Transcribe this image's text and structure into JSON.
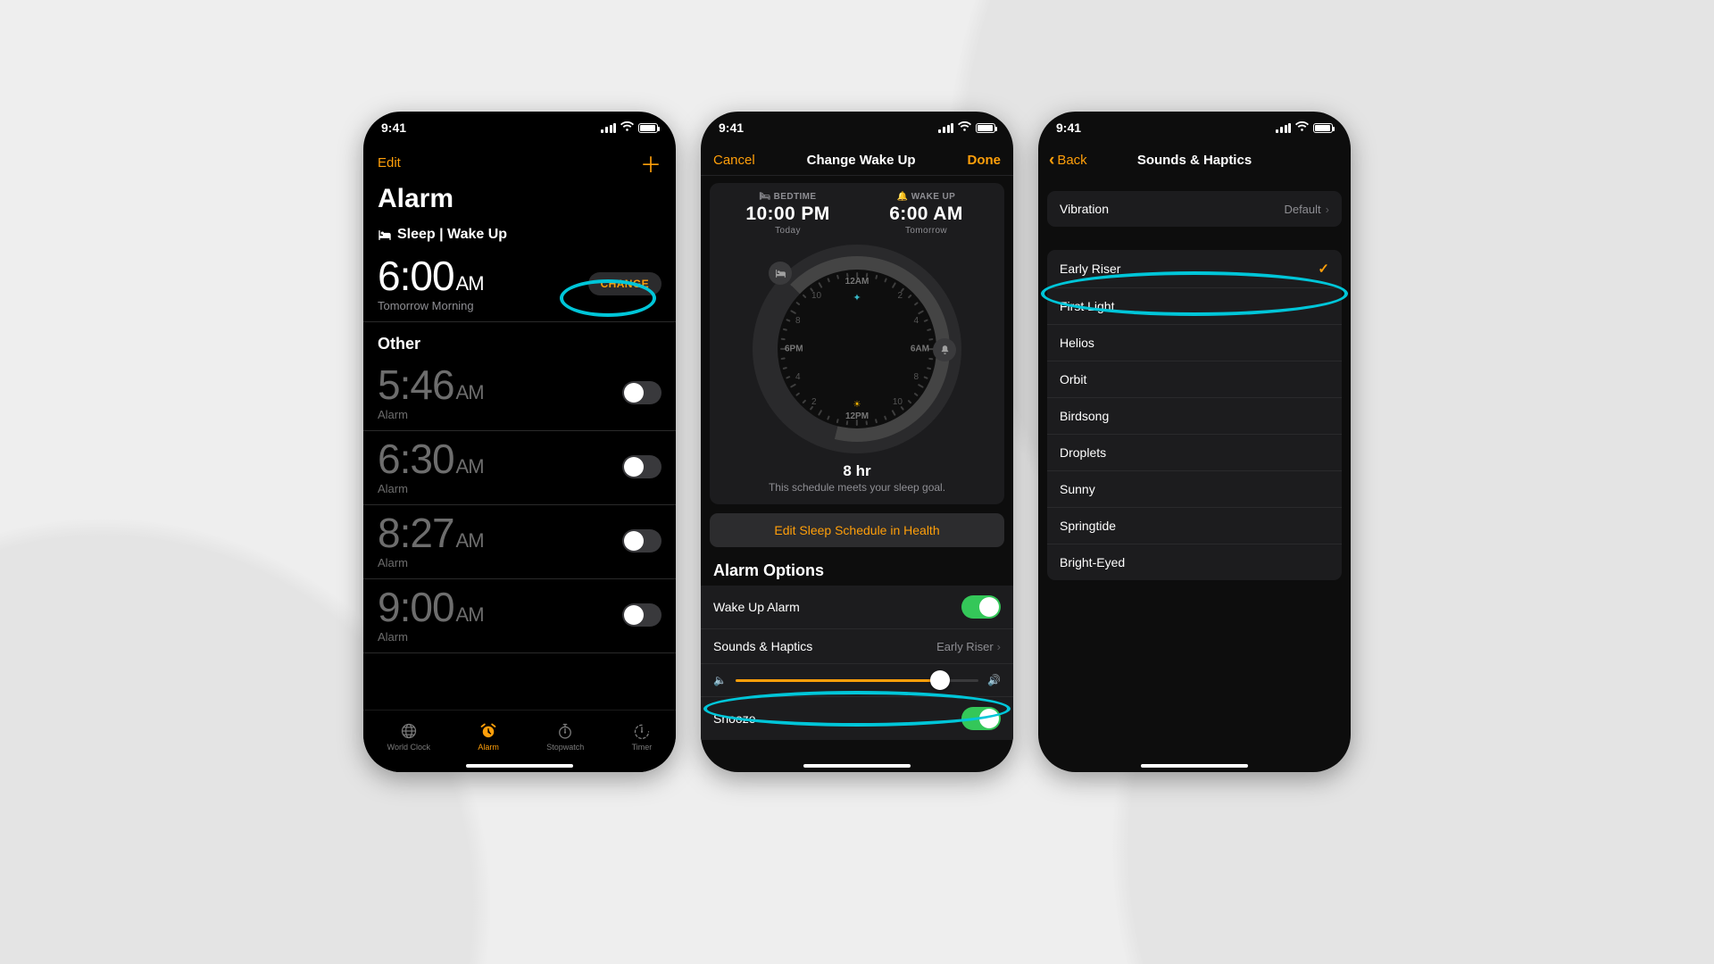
{
  "status_time": "9:41",
  "phone1": {
    "edit": "Edit",
    "title": "Alarm",
    "sleep_section": "Sleep | Wake Up",
    "main_time": "6:00",
    "main_ampm": "AM",
    "main_sub": "Tomorrow Morning",
    "change": "CHANGE",
    "other": "Other",
    "alarms": [
      {
        "time": "5:46",
        "ampm": "AM",
        "label": "Alarm",
        "on": false
      },
      {
        "time": "6:30",
        "ampm": "AM",
        "label": "Alarm",
        "on": false
      },
      {
        "time": "8:27",
        "ampm": "AM",
        "label": "Alarm",
        "on": false
      },
      {
        "time": "9:00",
        "ampm": "AM",
        "label": "Alarm",
        "on": false
      }
    ],
    "tabs": [
      {
        "label": "World Clock"
      },
      {
        "label": "Alarm"
      },
      {
        "label": "Stopwatch"
      },
      {
        "label": "Timer"
      }
    ]
  },
  "phone2": {
    "cancel": "Cancel",
    "title": "Change Wake Up",
    "done": "Done",
    "bed_label": "BEDTIME",
    "bed_time": "10:00 PM",
    "bed_day": "Today",
    "wake_label": "WAKE UP",
    "wake_time": "6:00 AM",
    "wake_day": "Tomorrow",
    "face": {
      "top": "12AM",
      "bot": "12PM",
      "left": "6PM",
      "right": "6AM"
    },
    "face_nums": {
      "n1": "2",
      "n2": "4",
      "n3": "8",
      "n4": "10",
      "n5": "2",
      "n6": "4",
      "n7": "8",
      "n8": "10"
    },
    "goal_hours": "8 hr",
    "goal_text": "This schedule meets your sleep goal.",
    "edit_link": "Edit Sleep Schedule in Health",
    "opt_head": "Alarm Options",
    "opt_wake": "Wake Up Alarm",
    "opt_sounds": "Sounds & Haptics",
    "opt_sounds_val": "Early Riser",
    "opt_snooze": "Snooze"
  },
  "phone3": {
    "back": "Back",
    "title": "Sounds & Haptics",
    "vibration_label": "Vibration",
    "vibration_val": "Default",
    "sounds": [
      "Early Riser",
      "First Light",
      "Helios",
      "Orbit",
      "Birdsong",
      "Droplets",
      "Sunny",
      "Springtide",
      "Bright-Eyed"
    ],
    "selected_index": 0
  }
}
